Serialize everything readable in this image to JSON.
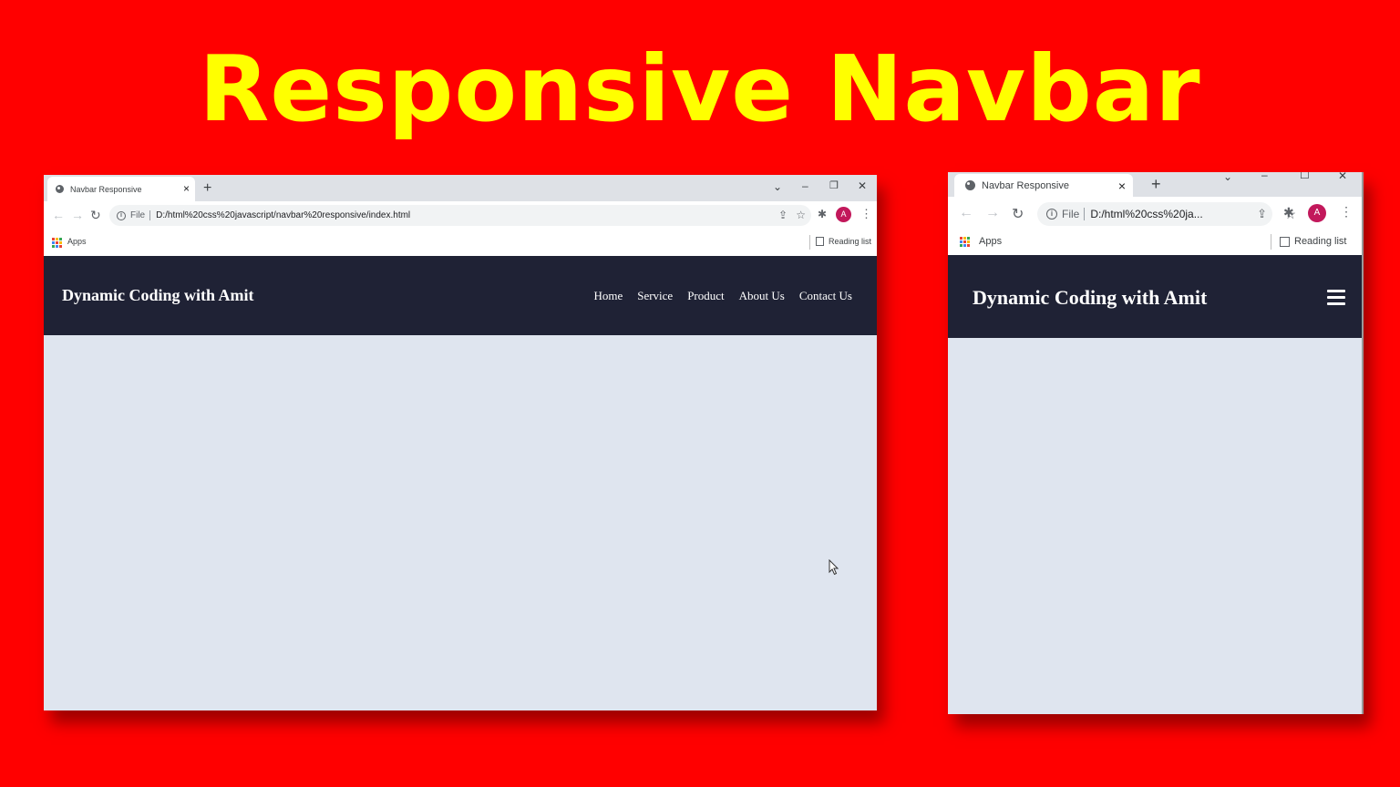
{
  "headline": "Responsive Navbar",
  "browser": {
    "tab_title": "Navbar Responsive",
    "tab_close": "×",
    "new_tab": "+",
    "omnibox_scheme": "File",
    "bookmarks_apps": "Apps",
    "reading_list": "Reading list",
    "avatar_letter": "A"
  },
  "desktop": {
    "url": "D:/html%20css%20javascript/navbar%20responsive/index.html"
  },
  "mobile": {
    "url": "D:/html%20css%20ja..."
  },
  "site": {
    "brand": "Dynamic Coding with Amit",
    "menu": [
      "Home",
      "Service",
      "Product",
      "About Us",
      "Contact Us"
    ],
    "nav_bg": "#1f2235",
    "page_bg": "#dfe5ef"
  },
  "colors": {
    "background": "#ff0000",
    "headline": "#ffff00",
    "avatar": "#c2185b"
  },
  "icons": {
    "back": "back-arrow-icon",
    "forward": "forward-arrow-icon",
    "reload": "reload-icon",
    "share": "share-icon",
    "star": "star-icon",
    "extensions": "puzzle-icon",
    "menu": "kebab-menu-icon",
    "hamburger": "hamburger-menu-icon"
  }
}
